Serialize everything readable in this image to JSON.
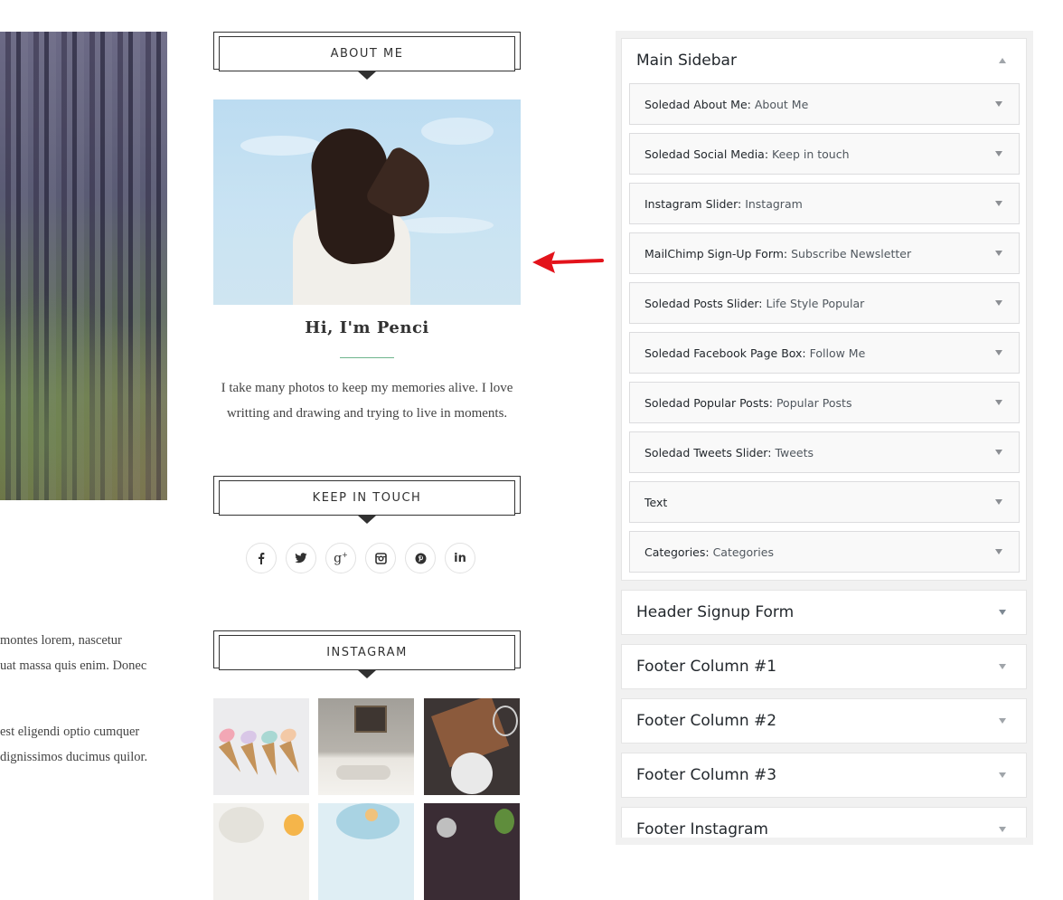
{
  "post": {
    "lines": [
      "montes lorem, nascetur",
      "uat massa quis enim. Donec",
      "est eligendi optio cumquer",
      "dignissimos ducimus quilor."
    ]
  },
  "about": {
    "title": "ABOUT ME",
    "name": "Hi, I'm Penci",
    "text_line1": "I take many photos to keep my memories alive. I love",
    "text_line2": "writting and drawing and trying to live in moments."
  },
  "touch": {
    "title": "KEEP IN TOUCH",
    "icons": [
      {
        "icon": "facebook-icon",
        "glyph": "f"
      },
      {
        "icon": "twitter-icon",
        "glyph": "🐦"
      },
      {
        "icon": "google-plus-icon",
        "glyph": "g+"
      },
      {
        "icon": "instagram-icon",
        "glyph": "◙"
      },
      {
        "icon": "pinterest-icon",
        "glyph": "℗"
      },
      {
        "icon": "linkedin-icon",
        "glyph": "in"
      }
    ]
  },
  "instagram": {
    "title": "INSTAGRAM"
  },
  "admin": {
    "main_sidebar": {
      "title": "Main Sidebar",
      "widgets": [
        {
          "name": "Soledad About Me:",
          "sub": "About Me"
        },
        {
          "name": "Soledad Social Media:",
          "sub": "Keep in touch"
        },
        {
          "name": "Instagram Slider:",
          "sub": "Instagram"
        },
        {
          "name": "MailChimp Sign-Up Form:",
          "sub": "Subscribe Newsletter"
        },
        {
          "name": "Soledad Posts Slider:",
          "sub": "Life Style Popular"
        },
        {
          "name": "Soledad Facebook Page Box:",
          "sub": "Follow Me"
        },
        {
          "name": "Soledad Popular Posts:",
          "sub": "Popular Posts"
        },
        {
          "name": "Soledad Tweets Slider:",
          "sub": "Tweets"
        },
        {
          "name": "Text",
          "sub": ""
        },
        {
          "name": "Categories:",
          "sub": "Categories"
        }
      ]
    },
    "areas": [
      {
        "title": "Header Signup Form"
      },
      {
        "title": "Footer Column #1"
      },
      {
        "title": "Footer Column #2"
      },
      {
        "title": "Footer Column #3"
      },
      {
        "title": "Footer Instagram"
      }
    ]
  },
  "colors": {
    "accent_arrow": "#e3131b",
    "about_divider": "#6eb48c"
  }
}
